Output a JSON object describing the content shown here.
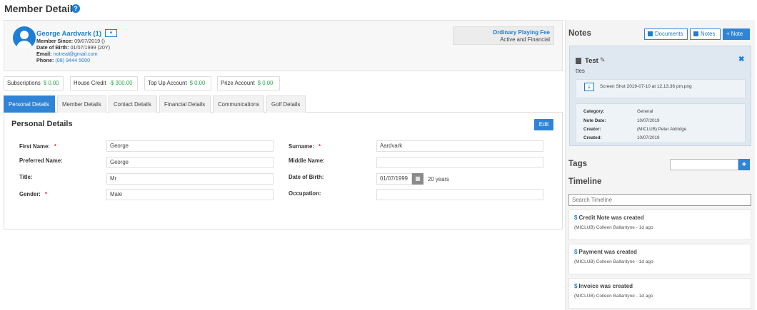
{
  "header": {
    "title": "Member Details",
    "help_icon": "?"
  },
  "member": {
    "name": "George Aardvark (1)",
    "dropdown_icon": "▾",
    "member_since_label": "Member Since:",
    "member_since": "09/07/2019 ()",
    "dob_label": "Date of Birth:",
    "dob": "01/07/1999 (20Y)",
    "email_label": "Email:",
    "email": "notreal@gmail.com",
    "phone_label": "Phone:",
    "phone": "(08) 9444 5000",
    "membership_type": "Ordinary Playing Fee",
    "membership_status": "Active and Financial"
  },
  "accounts": [
    {
      "label": "Subscriptions",
      "value": "$ 0.00"
    },
    {
      "label": "House Credit",
      "value": "-$ 300.00"
    },
    {
      "label": "Top Up Account",
      "value": "$ 0.00"
    },
    {
      "label": "Prize Account",
      "value": "$ 0.00"
    }
  ],
  "tabs": [
    "Personal Details",
    "Member Details",
    "Contact Details",
    "Financial Details",
    "Communications",
    "Golf Details"
  ],
  "personal": {
    "heading": "Personal Details",
    "edit_label": "Edit",
    "required_mark": "*",
    "first_name_label": "First Name:",
    "first_name": "George",
    "surname_label": "Surname:",
    "surname": "Aardvark",
    "preferred_name_label": "Preferred Name:",
    "preferred_name": "George",
    "middle_name_label": "Middle Name:",
    "middle_name": "",
    "title_label": "Title:",
    "title": "Mr",
    "dob_label": "Date of Birth:",
    "dob": "01/07/1999",
    "age": "20 years",
    "gender_label": "Gender:",
    "gender": "Male",
    "occupation_label": "Occupation:",
    "occupation": ""
  },
  "notes": {
    "heading": "Notes",
    "documents_button": "Documents",
    "notes_button": "Notes",
    "add_note_button": "+ Note",
    "card": {
      "title": "Test",
      "body": "ttes",
      "attachment": "Screen Shot 2019-07-10 at 12.13.36 pm.png",
      "category_label": "Category:",
      "category": "General",
      "note_date_label": "Note Date:",
      "note_date": "10/07/2019",
      "creator_label": "Creator:",
      "creator": "(MICLUB) Peter Aldridge",
      "created_label": "Created:",
      "created": "10/07/2019",
      "close_icon": "✖",
      "pencil_icon": "✎",
      "download_icon": "⤓"
    }
  },
  "tags": {
    "heading": "Tags",
    "add_icon": "+"
  },
  "timeline": {
    "heading": "Timeline",
    "search_placeholder": "Search Timeline",
    "dollar_icon": "$",
    "items": [
      {
        "title": "Credit Note was created",
        "meta": "(MICLUB) Colleen Ballantyne - 1d ago"
      },
      {
        "title": "Payment was created",
        "meta": "(MICLUB) Colleen Ballantyne - 1d ago"
      },
      {
        "title": "Invoice was created",
        "meta": "(MICLUB) Colleen Ballantyne - 1d ago"
      }
    ]
  }
}
